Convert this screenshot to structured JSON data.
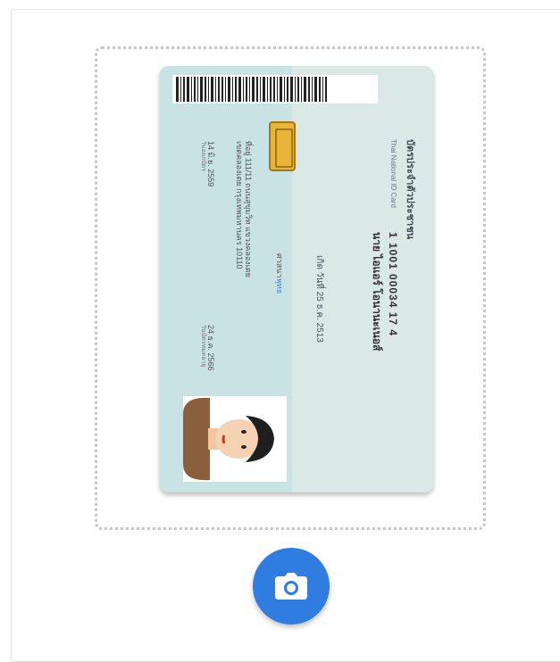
{
  "card": {
    "title": "บัตรประจำตัวประชาชน",
    "subtitle": "Thai National ID Card",
    "id_number": "1 1001 00034 17 4",
    "name": "นาย ไอแอร์ โอนานะเนอส์",
    "dob": "เกิด วันที่ 25 ธ.ค. 2513",
    "religion_label": "ศาสนา",
    "religion_value": "พุทธ",
    "address_line1": "ที่อยู่ 111/11 ถนนสุขุมวิท แขวงคลองเตย",
    "address_line2": "เขตคลองเตย กรุงเทพมหานคร 10110",
    "issue_date": "14 มิ.ย. 2559",
    "issue_label": "วันออกบัตร",
    "expiry_date": "24 ธ.ค. 2566",
    "expiry_label": "วันบัตรหมดอายุ"
  },
  "icons": {
    "camera": "camera-icon",
    "chip": "sim-chip-icon",
    "barcode": "barcode-icon",
    "avatar": "person-avatar-icon"
  },
  "colors": {
    "camera_button": "#2f7de0",
    "card_left": "#c9e3e5",
    "card_right": "#dbe9e6",
    "chip": "#e8b43a"
  }
}
